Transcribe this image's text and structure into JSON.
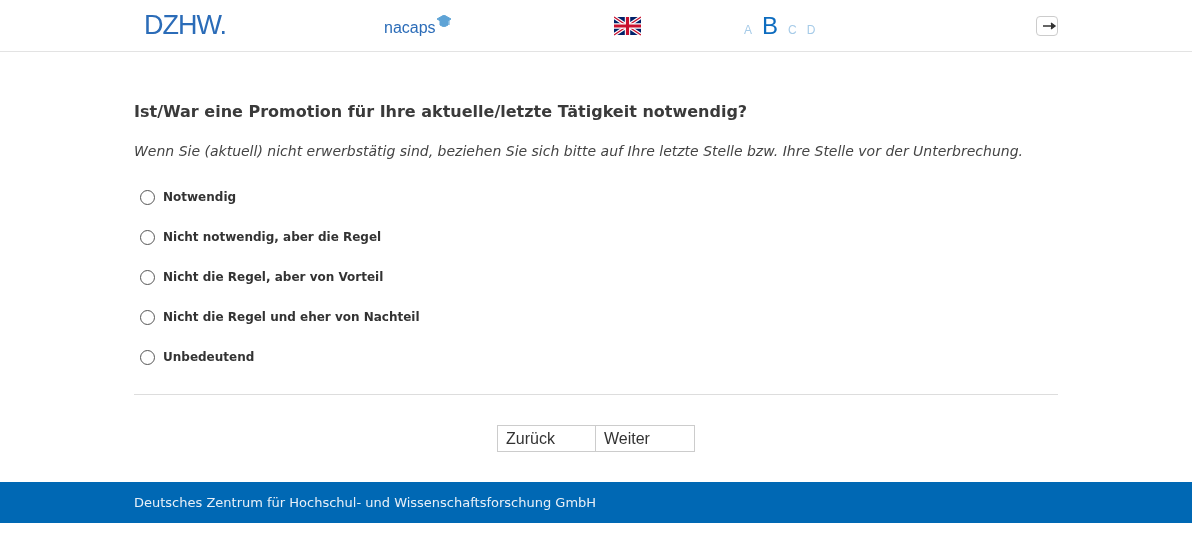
{
  "header": {
    "logo": "DZHW.",
    "brand": "nacaps",
    "steps": [
      {
        "label": "A",
        "selected": false
      },
      {
        "label": "B",
        "selected": true
      },
      {
        "label": "C",
        "selected": false
      },
      {
        "label": "D",
        "selected": false
      }
    ]
  },
  "question": "Ist/War eine Promotion für Ihre aktuelle/letzte Tätigkeit notwendig?",
  "note": "Wenn Sie (aktuell) nicht erwerbstätig sind, beziehen Sie sich bitte auf Ihre letzte Stelle bzw. Ihre Stelle vor der Unterbrechung.",
  "options": [
    {
      "label": "Notwendig",
      "selected": false
    },
    {
      "label": "Nicht notwendig, aber die Regel",
      "selected": false
    },
    {
      "label": "Nicht die Regel, aber von Vorteil",
      "selected": false
    },
    {
      "label": "Nicht die Regel und eher von Nachteil",
      "selected": false
    },
    {
      "label": "Unbedeutend",
      "selected": false
    }
  ],
  "buttons": [
    "Zurück",
    "Weiter"
  ],
  "footer": "Deutsches Zentrum für Hochschul- und Wissenschaftsforschung GmbH"
}
